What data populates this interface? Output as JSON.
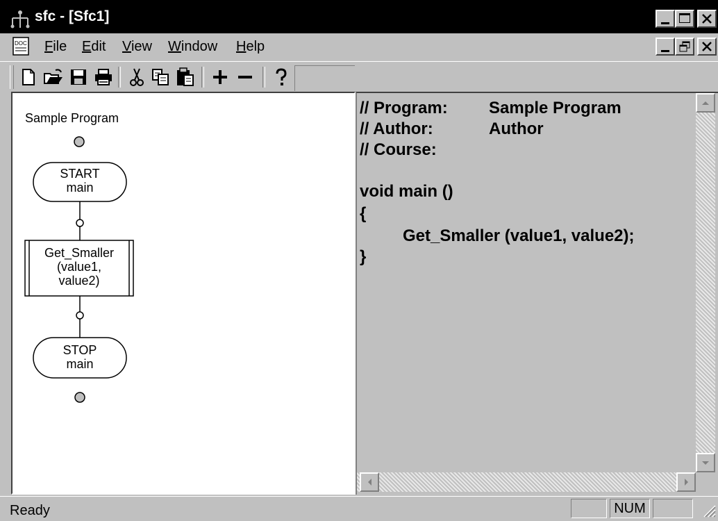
{
  "window": {
    "title": "sfc - [Sfc1]"
  },
  "menu": {
    "items": [
      {
        "label": "File",
        "underline": "F",
        "rest": "ile"
      },
      {
        "label": "Edit",
        "underline": "E",
        "rest": "dit"
      },
      {
        "label": "View",
        "underline": "V",
        "rest": "iew"
      },
      {
        "label": "Window",
        "underline": "W",
        "rest": "indow"
      },
      {
        "label": "Help",
        "underline": "H",
        "rest": "elp"
      }
    ]
  },
  "toolbar": {
    "icons": [
      "new-file-icon",
      "open-folder-icon",
      "save-disk-icon",
      "print-icon",
      "cut-scissors-icon",
      "copy-icon",
      "paste-icon",
      "plus-icon",
      "minus-icon",
      "help-question-icon"
    ]
  },
  "flowchart": {
    "title": "Sample Program",
    "start_line1": "START",
    "start_line2": "main",
    "process_line1": "Get_Smaller",
    "process_line2": "(value1,",
    "process_line3": "value2)",
    "stop_line1": "STOP",
    "stop_line2": "main"
  },
  "code": {
    "program_comment": "// Program:",
    "program_value": "Sample Program",
    "author_comment": "// Author:",
    "author_value": "Author",
    "course_comment": "// Course:",
    "func_decl": "void main ()",
    "open_brace": "{",
    "statement": "Get_Smaller (value1, value2);",
    "close_brace": "}"
  },
  "status": {
    "text": "Ready",
    "num": "NUM"
  }
}
